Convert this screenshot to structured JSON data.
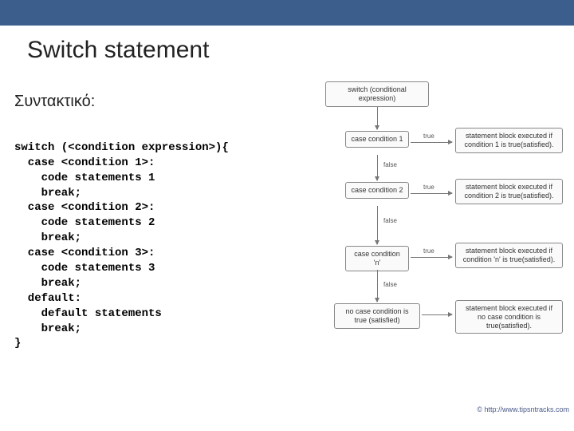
{
  "title": "Switch statement",
  "subhead": "Συντακτικό:",
  "code": {
    "l0": "switch (<condition expression>){",
    "l1": "  case <condition 1>:",
    "l2": "    code statements 1",
    "l3": "    break;",
    "l4": "  case <condition 2>:",
    "l5": "    code statements 2",
    "l6": "    break;",
    "l7": "  case <condition 3>:",
    "l8": "    code statements 3",
    "l9": "    break;",
    "l10": "  default:",
    "l11": "    default statements",
    "l12": "    break;",
    "l13": "}"
  },
  "flow": {
    "switch_label": "switch\n(conditional expression)",
    "case1": "case\ncondition 1",
    "case2": "case\ncondition 2",
    "casen": "case\ncondition 'n'",
    "default_box": "no case condition is\ntrue (satisfied)",
    "stmt1": "statement block executed\nif condition 1 is\ntrue(satisfied).",
    "stmt2": "statement block executed\nif condition 2 is\ntrue(satisfied).",
    "stmtn": "statement block executed\nif condition 'n' is\ntrue(satisfied).",
    "stmtd": "statement block executed\nif no case condition is\ntrue(satisfied).",
    "true": "true",
    "false": "false",
    "credit": "© http://www.tipsntracks.com"
  },
  "chart_data": {
    "type": "diagram",
    "kind": "flowchart",
    "title": "switch statement control flow",
    "nodes": [
      {
        "id": "switch",
        "label": "switch (conditional expression)",
        "shape": "rounded-rect"
      },
      {
        "id": "c1",
        "label": "case condition 1",
        "shape": "rounded-rect"
      },
      {
        "id": "c2",
        "label": "case condition 2",
        "shape": "rounded-rect"
      },
      {
        "id": "cn",
        "label": "case condition 'n'",
        "shape": "rounded-rect"
      },
      {
        "id": "def",
        "label": "no case condition is true (satisfied)",
        "shape": "rounded-rect"
      },
      {
        "id": "s1",
        "label": "statement block executed if condition 1 is true(satisfied).",
        "shape": "rounded-rect"
      },
      {
        "id": "s2",
        "label": "statement block executed if condition 2 is true(satisfied).",
        "shape": "rounded-rect"
      },
      {
        "id": "sn",
        "label": "statement block executed if condition 'n' is true(satisfied).",
        "shape": "rounded-rect"
      },
      {
        "id": "sd",
        "label": "statement block executed if no case condition is true(satisfied).",
        "shape": "rounded-rect"
      }
    ],
    "edges": [
      {
        "from": "switch",
        "to": "c1",
        "label": ""
      },
      {
        "from": "c1",
        "to": "s1",
        "label": "true"
      },
      {
        "from": "c1",
        "to": "c2",
        "label": "false"
      },
      {
        "from": "c2",
        "to": "s2",
        "label": "true"
      },
      {
        "from": "c2",
        "to": "cn",
        "label": "false"
      },
      {
        "from": "cn",
        "to": "sn",
        "label": "true"
      },
      {
        "from": "cn",
        "to": "def",
        "label": "false"
      },
      {
        "from": "def",
        "to": "sd",
        "label": ""
      }
    ]
  }
}
